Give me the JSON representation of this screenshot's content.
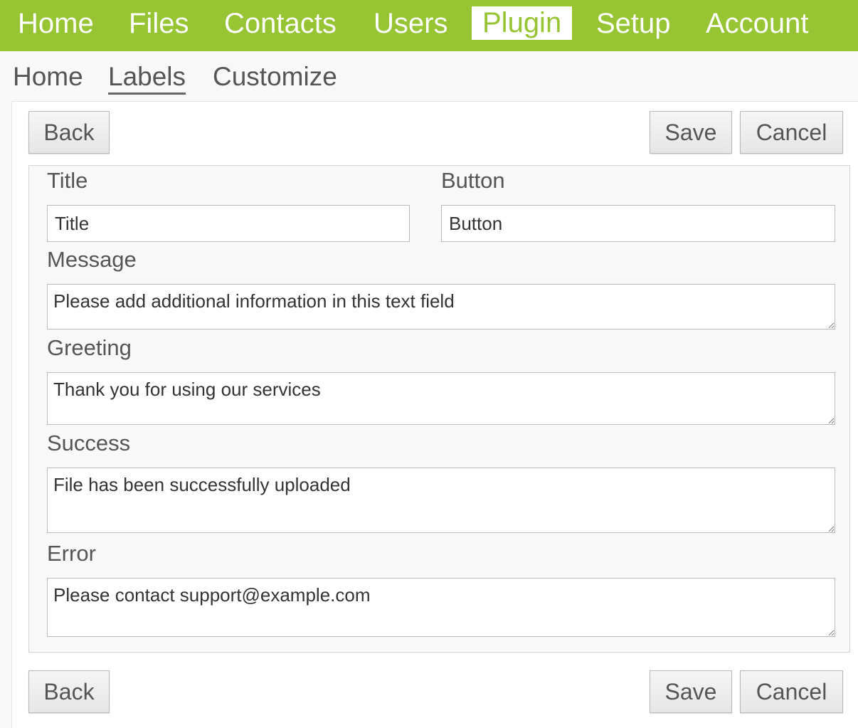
{
  "top_nav": {
    "items": [
      {
        "label": "Home"
      },
      {
        "label": "Files"
      },
      {
        "label": "Contacts"
      },
      {
        "label": "Users"
      },
      {
        "label": "Plugin"
      },
      {
        "label": "Setup"
      },
      {
        "label": "Account"
      }
    ],
    "active": "Plugin",
    "accent_color": "#96c432"
  },
  "sub_nav": {
    "items": [
      {
        "label": "Home"
      },
      {
        "label": "Labels"
      },
      {
        "label": "Customize"
      }
    ],
    "active": "Labels"
  },
  "toolbar": {
    "back_label": "Back",
    "save_label": "Save",
    "cancel_label": "Cancel"
  },
  "form": {
    "title": {
      "label": "Title",
      "value": "Title"
    },
    "button": {
      "label": "Button",
      "value": "Button"
    },
    "message": {
      "label": "Message",
      "value": "Please add additional information in this text field"
    },
    "greeting": {
      "label": "Greeting",
      "value": "Thank you for using our services"
    },
    "success": {
      "label": "Success",
      "value": "File has been successfully uploaded"
    },
    "error": {
      "label": "Error",
      "value": "Please contact support@example.com"
    }
  }
}
